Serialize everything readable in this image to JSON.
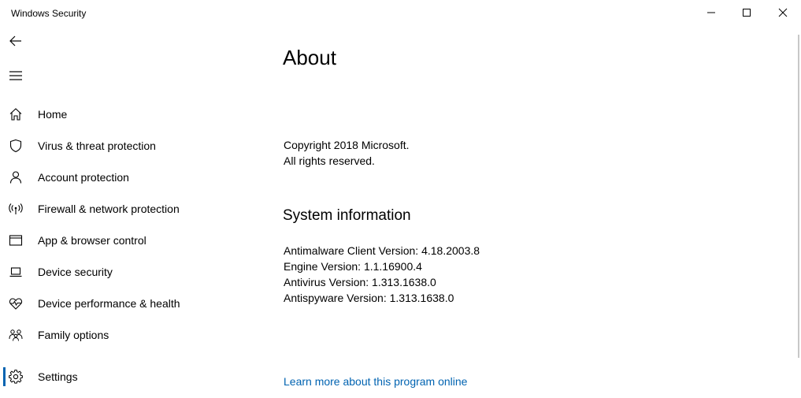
{
  "window": {
    "title": "Windows Security"
  },
  "sidebar": {
    "items": [
      {
        "label": "Home",
        "icon": "home-icon"
      },
      {
        "label": "Virus & threat protection",
        "icon": "shield-icon"
      },
      {
        "label": "Account protection",
        "icon": "person-icon"
      },
      {
        "label": "Firewall & network protection",
        "icon": "antenna-icon"
      },
      {
        "label": "App & browser control",
        "icon": "app-window-icon"
      },
      {
        "label": "Device security",
        "icon": "laptop-icon"
      },
      {
        "label": "Device performance & health",
        "icon": "heart-pulse-icon"
      },
      {
        "label": "Family options",
        "icon": "family-icon"
      },
      {
        "label": "Settings",
        "icon": "gear-icon",
        "selected": true
      }
    ]
  },
  "main": {
    "title": "About",
    "copyright_line1": "Copyright 2018 Microsoft.",
    "copyright_line2": "All rights reserved.",
    "system_info_title": "System information",
    "system_info": [
      "Antimalware Client Version: 4.18.2003.8",
      "Engine Version: 1.1.16900.4",
      "Antivirus Version: 1.313.1638.0",
      "Antispyware Version: 1.313.1638.0"
    ],
    "learn_more_link": "Learn more about this program online"
  },
  "colors": {
    "accent": "#0063b1",
    "background": "#ffffff",
    "text": "#000000"
  }
}
